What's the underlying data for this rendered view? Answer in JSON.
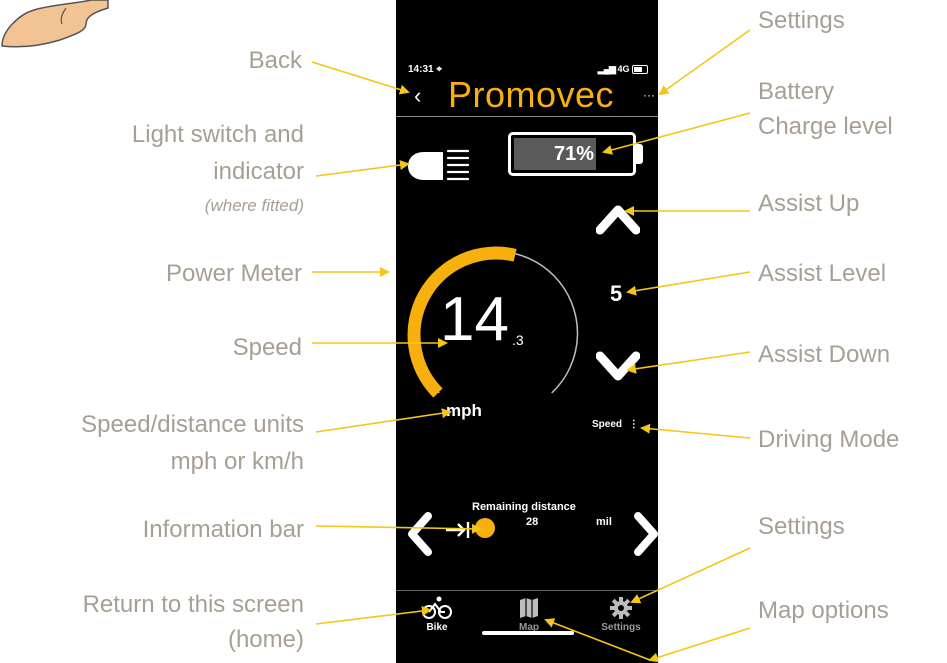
{
  "annotations": {
    "back": "Back",
    "light_line1": "Light switch and",
    "light_line2": "indicator",
    "light_note": "(where fitted)",
    "power_meter": "Power  Meter",
    "speed": "Speed",
    "units_line1": "Speed/distance units",
    "units_line2": "mph or km/h",
    "info_bar": "Information bar",
    "return_line1": "Return to this screen",
    "return_line2": "(home)",
    "settings_top": "Settings",
    "battery_line1": "Battery",
    "battery_line2": "Charge level",
    "assist_up": "Assist Up",
    "assist_level": "Assist Level",
    "assist_down": "Assist Down",
    "driving_mode": "Driving Mode",
    "settings_bottom": "Settings",
    "map_options": "Map options"
  },
  "phone": {
    "status_time": "14:31 ⌖",
    "status_network": "4G",
    "back_glyph": "‹",
    "brand_first": "Pr",
    "brand_rest": "omovec",
    "menu_glyph": "···",
    "battery_percent_label": "71%",
    "battery_level": 0.71,
    "assist_level": "5",
    "power_level": 0.55,
    "speed_int": "14",
    "speed_dec": ".3",
    "units": "mph",
    "mode_label": "Speed",
    "mode_glyph": "⋮",
    "info_title": "Remaining distance",
    "info_value": "28",
    "info_unit": "mil",
    "tabs": [
      {
        "label": "Bike",
        "icon": "bicycle-icon"
      },
      {
        "label": "Map",
        "icon": "map-icon"
      },
      {
        "label": "Settings",
        "icon": "gear-icon"
      }
    ]
  },
  "colors": {
    "accent": "#f7b00e",
    "annotation_text": "#a89f94",
    "arrow": "#f5c518",
    "background_app": "#000000"
  }
}
